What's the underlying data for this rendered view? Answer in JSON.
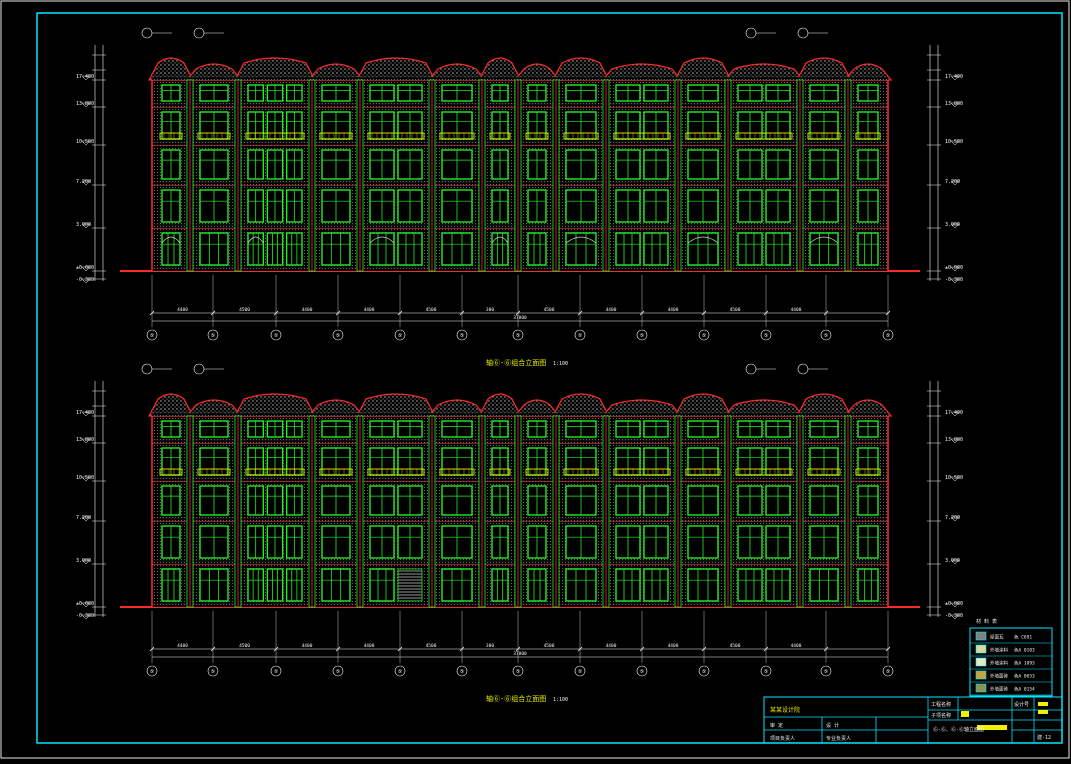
{
  "colors": {
    "background": "#000000",
    "frame": "#00e5ff",
    "wall": "#ff2a2a",
    "window": "#22ee22",
    "hatch": "#cfcfcf",
    "dimension": "#f5f5f5",
    "accent": "#ffe000"
  },
  "drawing": {
    "top_title": "轴⑥-⑥组合立面图",
    "top_scale": "1:100",
    "bottom_title": "轴⑥-⑥组合立面图",
    "bottom_scale": "1:100",
    "total_width_dim": "37800",
    "bay_dims": [
      "4400",
      "4500",
      "4400",
      "4400",
      "4500",
      "300",
      "4500",
      "4400",
      "4400",
      "4500",
      "4400"
    ],
    "level_labels": [
      "-0.300",
      "±0.000",
      "3.900",
      "7.200",
      "10.500",
      "13.800",
      "17.400"
    ],
    "grid_axis_label": "⑤"
  },
  "legend": {
    "title": "材 料 表",
    "items": [
      {
        "label": "屋面瓦",
        "code": "色 C691",
        "color": "#808080"
      },
      {
        "label": "外墙涂料",
        "code": "色A 0103",
        "color": "#d8d8a0"
      },
      {
        "label": "外墙涂料",
        "code": "色A 1893",
        "color": "#e8e8c0"
      },
      {
        "label": "外墙面砖",
        "code": "色A 0653",
        "color": "#c8a040"
      },
      {
        "label": "外墙面砖",
        "code": "色A 0154",
        "color": "#909050"
      }
    ]
  },
  "title_block": {
    "company": "某某设计院",
    "project_label": "工程名称",
    "subproject_label": "子项名称",
    "drawing_no_label": "设计号",
    "sheet_title": "⑥-⑥、⑥-⑥轴立面图",
    "row2_a": "审 定",
    "row2_b": "设 计",
    "row3_a": "项目负责人",
    "row3_b": "专业负责人",
    "sheet_no": "建-12"
  }
}
